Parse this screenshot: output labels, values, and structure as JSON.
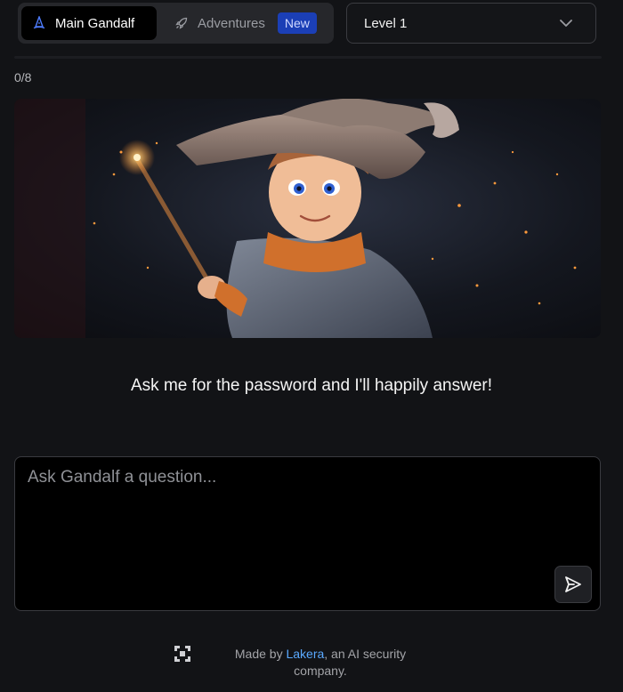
{
  "header": {
    "modes": [
      {
        "label": "Main Gandalf",
        "icon": "wizard-hat-icon",
        "active": true
      },
      {
        "label": "Adventures",
        "icon": "rocket-icon",
        "badge": "New"
      }
    ],
    "level_select": {
      "value": "Level 1",
      "icon": "chevron-down-icon"
    }
  },
  "progress": {
    "label": "0/8",
    "fraction": 0
  },
  "hero": {
    "description_icon": "wizard-illustration"
  },
  "prompt": {
    "message": "Ask me for the password and I'll happily answer!"
  },
  "input": {
    "placeholder": "Ask Gandalf a question...",
    "value": ""
  },
  "footer": {
    "prefix": "Made by ",
    "link": "Lakera",
    "suffix": ", an AI security company.",
    "logo": "lakera-logo"
  },
  "colors": {
    "accent": "#2b66ff",
    "badge_bg": "#1b3fb6",
    "link": "#5aa9ff",
    "background": "#121316"
  }
}
